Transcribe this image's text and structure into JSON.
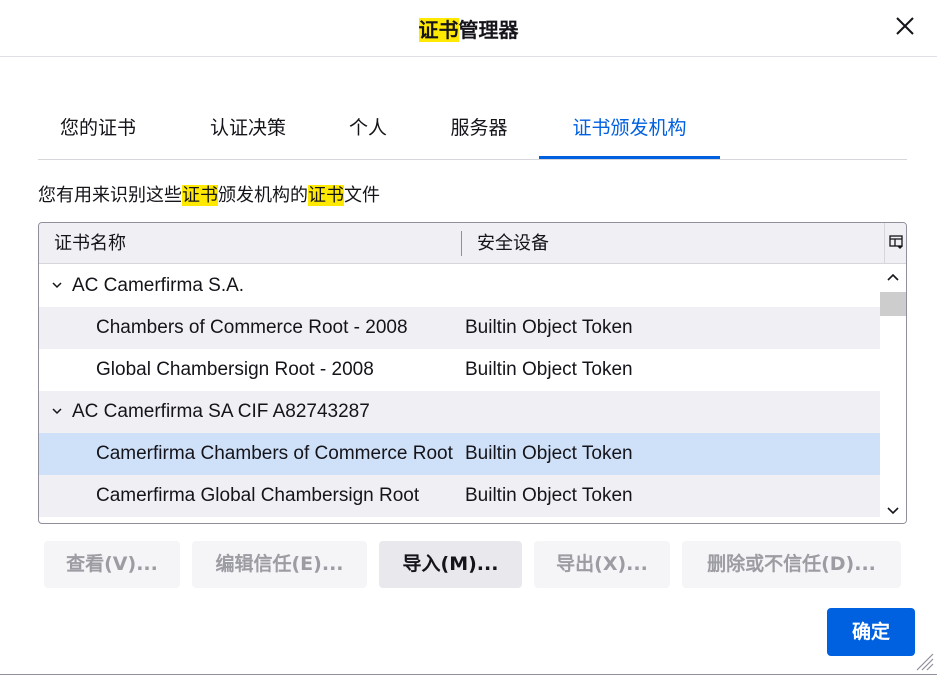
{
  "window": {
    "title_highlight": "证书",
    "title_rest": "管理器"
  },
  "tabs": [
    {
      "label": "您的证书"
    },
    {
      "label": "认证决策"
    },
    {
      "label": "个人"
    },
    {
      "label": "服务器"
    },
    {
      "label": "证书颁发机构",
      "active": true
    }
  ],
  "description": {
    "part1": "您有用来识别这些",
    "hl1": "证书",
    "part2": "颁发机构的",
    "hl2": "证书",
    "part3": "文件"
  },
  "tree": {
    "columns": {
      "name": "证书名称",
      "device": "安全设备"
    },
    "rows": [
      {
        "type": "group",
        "name": "AC Camerfirma S.A.",
        "device": ""
      },
      {
        "type": "cert",
        "name": "Chambers of Commerce Root - 2008",
        "device": "Builtin Object Token"
      },
      {
        "type": "cert",
        "name": "Global Chambersign Root - 2008",
        "device": "Builtin Object Token"
      },
      {
        "type": "group",
        "name": "AC Camerfirma SA CIF A82743287",
        "device": ""
      },
      {
        "type": "cert",
        "name": "Camerfirma Chambers of Commerce Root",
        "device": "Builtin Object Token",
        "selected": true
      },
      {
        "type": "cert",
        "name": "Camerfirma Global Chambersign Root",
        "device": "Builtin Object Token"
      }
    ]
  },
  "buttons": {
    "view": "查看(V)...",
    "edit": "编辑信任(E)...",
    "import": "导入(M)...",
    "export": "导出(X)...",
    "delete": "删除或不信任(D)...",
    "ok": "确定"
  },
  "colors": {
    "accent": "#0061e0",
    "highlight": "#ffe900",
    "selected_row": "#cfe1f8"
  }
}
